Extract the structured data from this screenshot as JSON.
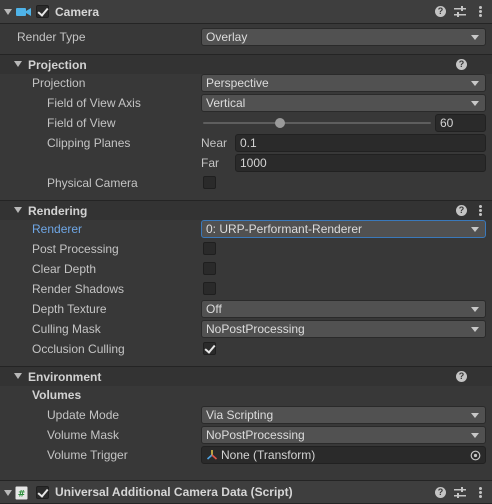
{
  "camera": {
    "title": "Camera",
    "enabled": true,
    "render_type": {
      "label": "Render Type",
      "value": "Overlay"
    }
  },
  "projection": {
    "title": "Projection",
    "projection": {
      "label": "Projection",
      "value": "Perspective"
    },
    "fov_axis": {
      "label": "Field of View Axis",
      "value": "Vertical"
    },
    "fov": {
      "label": "Field of View",
      "value": "60",
      "level_fraction": 0.5
    },
    "clipping": {
      "label": "Clipping Planes",
      "near_label": "Near",
      "near_value": "0.1",
      "far_label": "Far",
      "far_value": "1000"
    },
    "physical_camera": {
      "label": "Physical Camera",
      "checked": false
    }
  },
  "rendering": {
    "title": "Rendering",
    "renderer": {
      "label": "Renderer",
      "value": "0: URP-Performant-Renderer"
    },
    "post_processing": {
      "label": "Post Processing",
      "checked": false
    },
    "clear_depth": {
      "label": "Clear Depth",
      "checked": false
    },
    "render_shadows": {
      "label": "Render Shadows",
      "checked": false
    },
    "depth_texture": {
      "label": "Depth Texture",
      "value": "Off"
    },
    "culling_mask": {
      "label": "Culling Mask",
      "value": "NoPostProcessing"
    },
    "occlusion_culling": {
      "label": "Occlusion Culling",
      "checked": true
    }
  },
  "environment": {
    "title": "Environment",
    "volumes_label": "Volumes",
    "update_mode": {
      "label": "Update Mode",
      "value": "Via Scripting"
    },
    "volume_mask": {
      "label": "Volume Mask",
      "value": "NoPostProcessing"
    },
    "volume_trigger": {
      "label": "Volume Trigger",
      "value": "None (Transform)"
    }
  },
  "additional": {
    "title": "Universal Additional Camera Data (Script)",
    "enabled": true
  },
  "colors": {
    "background": "#383838",
    "accent_blue": "#6fa7e6",
    "camera_icon": "#4fb3e8"
  },
  "icons": [
    "camera-icon",
    "help-icon",
    "presets-icon",
    "kebab-menu-icon",
    "script-icon",
    "transform-icon",
    "object-picker-icon"
  ]
}
